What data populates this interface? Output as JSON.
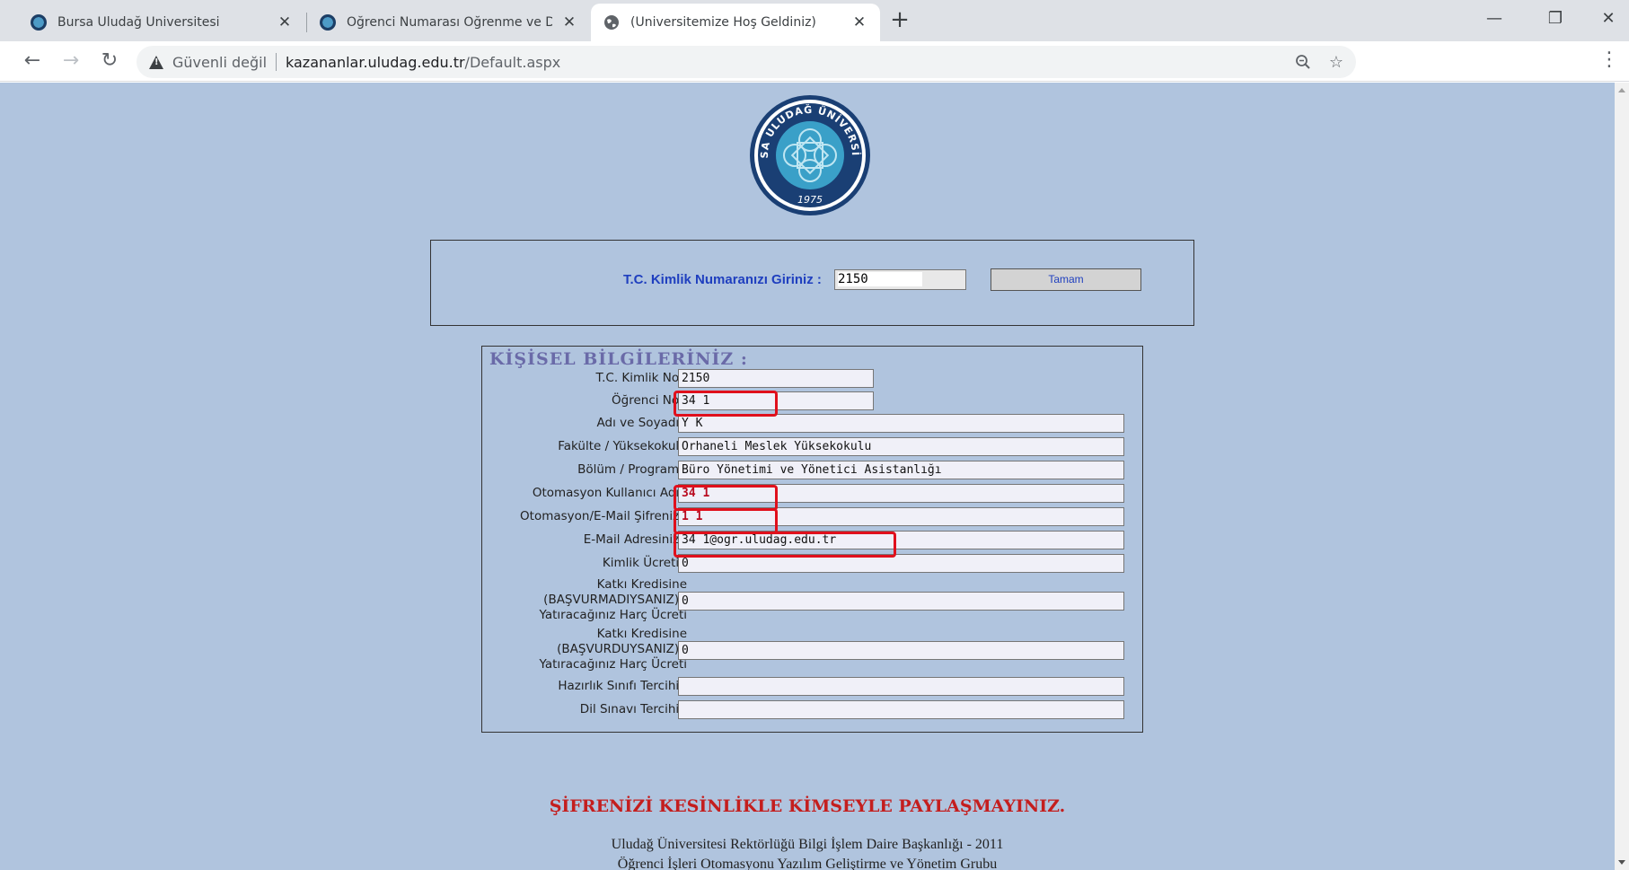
{
  "browser": {
    "tabs": [
      {
        "title": "Bursa Uludağ Üniversitesi",
        "favicon": "university-favicon"
      },
      {
        "title": "Öğrenci Numarası Öğrenme ve Diğer",
        "favicon": "university-favicon"
      },
      {
        "title": "(Üniversitemize Hoş Geldiniz)",
        "favicon": "globe-icon"
      }
    ],
    "address_bar": {
      "security_label": "Güvenli değil",
      "host": "kazananlar.uludag.edu.tr",
      "path": "/Default.aspx"
    }
  },
  "page": {
    "logo": {
      "text": "BURSA ULUDAĞ ÜNİVERSİTESİ",
      "year": "1975"
    },
    "tc_form": {
      "label": "T.C. Kimlik Numaranızı Giriniz :",
      "input_value": "2150",
      "button_label": "Tamam"
    },
    "info": {
      "heading": "KİŞİSEL BİLGİLERİNİZ :",
      "fields": [
        {
          "label": "T.C. Kimlik No :",
          "value": "2150"
        },
        {
          "label": "Öğrenci No :",
          "value": "34          1"
        },
        {
          "label": "Adı ve Soyadı :",
          "value": "Y        K"
        },
        {
          "label": "Fakülte / Yüksekokul :",
          "value": "Orhaneli Meslek Yüksekokulu"
        },
        {
          "label": "Bölüm / Program :",
          "value": "Büro Yönetimi ve Yönetici Asistanlığı"
        },
        {
          "label": "Otomasyon Kullanıcı Adı :",
          "value": "34          1"
        },
        {
          "label": "Otomasyon/E-Mail Şifreniz :",
          "value": "1       1"
        },
        {
          "label": "E-Mail Adresiniz :",
          "value": "34          1@ogr.uludag.edu.tr"
        },
        {
          "label": "Kimlik Ücreti :",
          "value": "0"
        },
        {
          "label_lines": [
            "Katkı Kredisine",
            "(BAŞVURMADIYSANIZ) :",
            "Yatıracağınız Harç Ücreti"
          ],
          "value": "0"
        },
        {
          "label_lines": [
            "Katkı Kredisine",
            "(BAŞVURDUYSANIZ) :",
            "Yatıracağınız Harç Ücreti"
          ],
          "value": "0"
        },
        {
          "label": "Hazırlık Sınıfı Tercihi :",
          "value": ""
        },
        {
          "label": "Dil Sınavı Tercihi :",
          "value": ""
        }
      ]
    },
    "warning": "ŞİFRENİZİ KESİNLİKLE KİMSEYLE PAYLAŞMAYINIZ.",
    "footer_line1": "Uludağ Üniversitesi Rektörlüğü Bilgi İşlem Daire Başkanlığı - 2011",
    "footer_line2": "Öğrenci İşleri Otomasyonu Yazılım Geliştirme ve Yönetim Grubu"
  },
  "colors": {
    "page_background": "#b0c4de",
    "label_blue": "#1f3fbf",
    "warning_red": "#c41e1e",
    "highlight_red": "#e0101c"
  }
}
